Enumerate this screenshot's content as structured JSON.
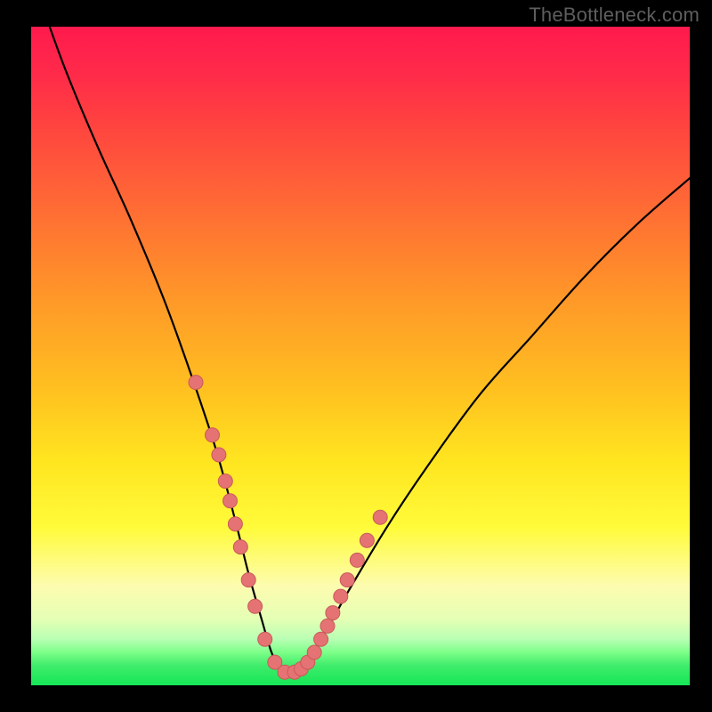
{
  "watermark": "TheBottleneck.com",
  "colors": {
    "page_bg": "#000000",
    "watermark_text": "#5e5e5e",
    "curve_stroke": "#000000",
    "marker_fill": "#e57373",
    "marker_stroke": "#c85a5a",
    "gradient_top": "#ff1a4d",
    "gradient_bottom": "#15e656"
  },
  "chart_data": {
    "type": "line",
    "title": "",
    "xlabel": "",
    "ylabel": "",
    "xlim": [
      0,
      100
    ],
    "ylim": [
      0,
      100
    ],
    "grid": false,
    "legend": false,
    "annotations": [],
    "series": [
      {
        "name": "curve",
        "x": [
          0,
          5,
          10,
          15,
          20,
          24,
          28,
          31,
          33,
          35,
          36.5,
          38,
          40,
          44,
          48,
          54,
          60,
          68,
          76,
          84,
          92,
          100
        ],
        "values": [
          108,
          94,
          82,
          71,
          59,
          48,
          36,
          25,
          17,
          10,
          5,
          2,
          2,
          7,
          14,
          24,
          33,
          44,
          53,
          62,
          70,
          77
        ]
      }
    ],
    "markers": {
      "name": "dots",
      "x": [
        25.0,
        27.5,
        28.5,
        29.5,
        30.2,
        31.0,
        31.8,
        33.0,
        34.0,
        35.5,
        37.0,
        38.5,
        40.0,
        41.0,
        42.0,
        43.0,
        44.0,
        45.0,
        45.8,
        47.0,
        48.0,
        49.5,
        51.0,
        53.0
      ],
      "values": [
        46.0,
        38.0,
        35.0,
        31.0,
        28.0,
        24.5,
        21.0,
        16.0,
        12.0,
        7.0,
        3.5,
        2.0,
        2.0,
        2.5,
        3.5,
        5.0,
        7.0,
        9.0,
        11.0,
        13.5,
        16.0,
        19.0,
        22.0,
        25.5
      ]
    }
  }
}
